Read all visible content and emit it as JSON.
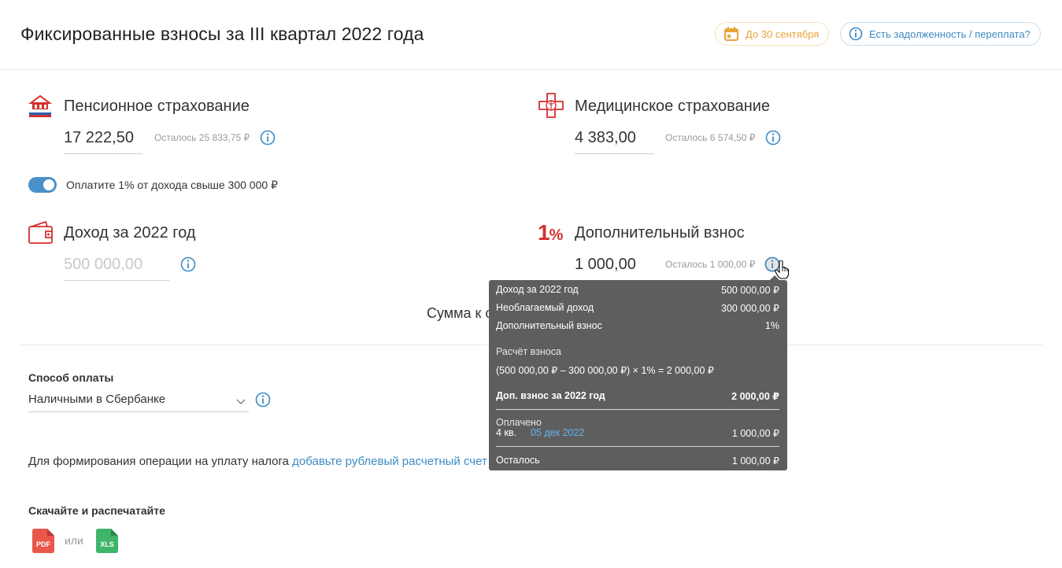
{
  "header": {
    "title": "Фиксированные взносы за III квартал 2022 года",
    "deadline": "До 30 сентября",
    "debt_link": "Есть задолженность / переплата?"
  },
  "pension": {
    "title": "Пенсионное страхование",
    "amount": "17 222,50",
    "remaining": "Осталось 25 833,75 ₽"
  },
  "medical": {
    "title": "Медицинское страхование",
    "amount": "4 383,00",
    "remaining": "Осталось 6 574,50 ₽"
  },
  "toggle": {
    "label": "Оплатите 1% от дохода свыше 300 000 ₽",
    "on": true
  },
  "income": {
    "title": "Доход за 2022 год",
    "placeholder": "500 000,00"
  },
  "additional": {
    "badge_number": "1",
    "badge_symbol": "%",
    "title": "Дополнительный взнос",
    "amount": "1 000,00",
    "remaining": "Осталось 1 000,00 ₽"
  },
  "sum_label": "Сумма к о",
  "payment": {
    "label": "Способ оплаты",
    "selected": "Наличными в Сбербанке"
  },
  "notice": {
    "text": "Для формирования операции на уплату налога ",
    "link": "добавьте рублевый расчетный счет"
  },
  "download": {
    "label": "Скачайте и распечатайте",
    "pdf": "PDF",
    "or": "или",
    "xls": "XLS"
  },
  "tooltip": {
    "income_label": "Доход за 2022 год",
    "income_value": "500 000,00 ₽",
    "untaxed_label": "Необлагаемый доход",
    "untaxed_value": "300 000,00 ₽",
    "additional_label": "Дополнительный взнос",
    "additional_value": "1%",
    "calc_label": "Расчёт взноса",
    "calc_formula": "(500 000,00 ₽ – 300 000,00 ₽) × 1% = 2 000,00 ₽",
    "total_label": "Доп. взнос за 2022 год",
    "total_value": "2 000,00 ₽",
    "paid_label": "Оплачено",
    "paid_quarter": "4 кв.",
    "paid_date": "05 дек 2022",
    "paid_value": "1 000,00 ₽",
    "left_label": "Осталось",
    "left_value": "1 000,00 ₽"
  },
  "colors": {
    "accent": "#3d8cc4",
    "brand_red": "#d32f2f",
    "deadline_orange": "#e6a43a",
    "tooltip_bg": "#5e5e5e"
  }
}
